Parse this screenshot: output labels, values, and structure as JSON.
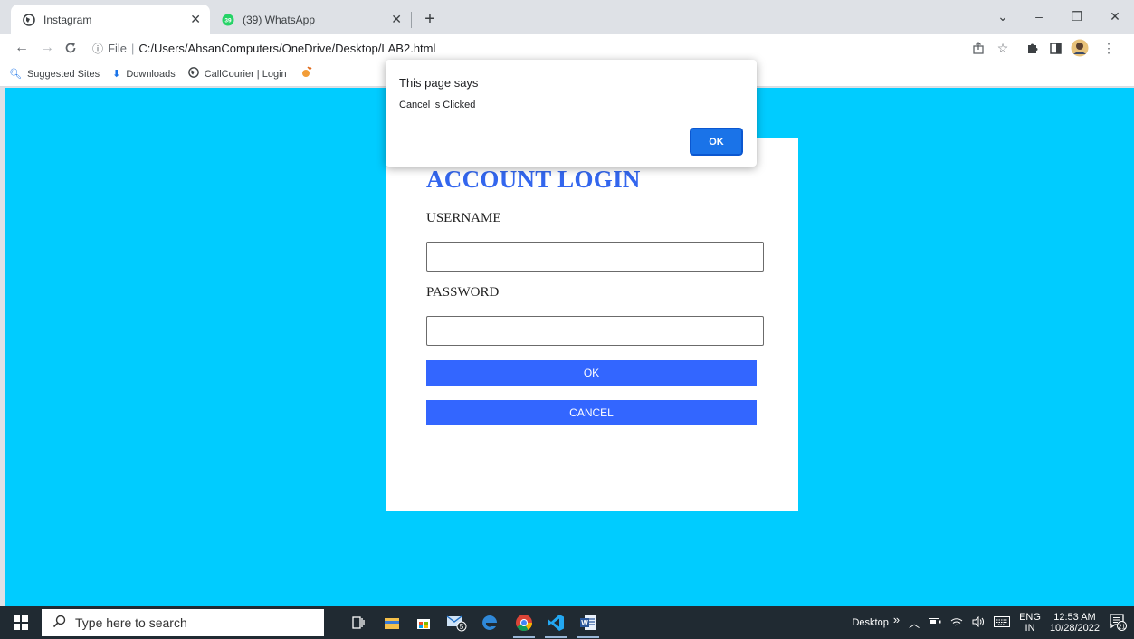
{
  "browser": {
    "tabs": [
      {
        "title": "Instagram",
        "icon": "globe-icon",
        "active": true
      },
      {
        "title": "(39) WhatsApp",
        "icon": "whatsapp-icon",
        "badge": "39",
        "active": false
      }
    ],
    "window_controls": {
      "dropdown": "⌄",
      "minimize": "–",
      "restore": "❐",
      "close": "✕"
    },
    "address": {
      "info_icon": "ⓘ",
      "scheme_label": "File",
      "separator": "|",
      "url": "C:/Users/AhsanComputers/OneDrive/Desktop/LAB2.html"
    },
    "bookmarks": [
      {
        "label": "Suggested Sites",
        "icon": "search-icon"
      },
      {
        "label": "Downloads",
        "icon": "download-icon"
      },
      {
        "label": "CallCourier | Login",
        "icon": "globe-icon"
      },
      {
        "label": "",
        "icon": "shopping-icon"
      }
    ]
  },
  "alert": {
    "title": "This page says",
    "message": "Cancel is Clicked",
    "ok_label": "OK"
  },
  "login": {
    "title": "ACCOUNT LOGIN",
    "username_label": "USERNAME",
    "username_value": "",
    "password_label": "PASSWORD",
    "password_value": "",
    "ok_label": "OK",
    "cancel_label": "CANCEL"
  },
  "taskbar": {
    "search_placeholder": "Type here to search",
    "mail_badge": "5",
    "tray": {
      "desktop_label": "Desktop",
      "overflow": "»",
      "language_top": "ENG",
      "language_bottom": "IN",
      "time": "12:53 AM",
      "date": "10/28/2022",
      "notifications": "21"
    }
  },
  "colors": {
    "page_background": "#00ccff",
    "title_blue": "#3366ee",
    "button_blue": "#3366ff",
    "dialog_button": "#1a73e8",
    "taskbar": "#202a32"
  }
}
